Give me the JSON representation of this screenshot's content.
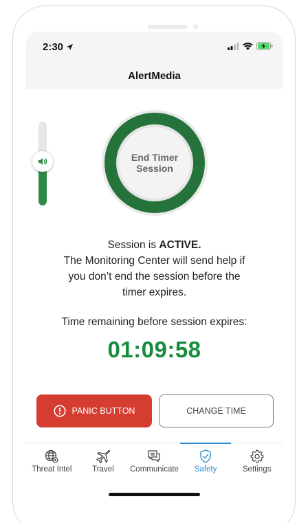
{
  "status_bar": {
    "time": "2:30",
    "icons": [
      "location-arrow-icon",
      "signal-icon",
      "wifi-icon",
      "battery-charging-icon"
    ]
  },
  "header": {
    "title": "AlertMedia"
  },
  "volume_slider": {
    "level": 0.45,
    "icon": "speaker-icon"
  },
  "timer_button": {
    "line1": "End Timer",
    "line2": "Session"
  },
  "session": {
    "prefix": "Session is ",
    "state": "ACTIVE.",
    "line2": "The Monitoring Center will send help if",
    "line3": "you don’t end the session before the",
    "line4": "timer expires."
  },
  "remaining": {
    "label": "Time remaining before session expires:",
    "time": "01:09:58"
  },
  "actions": {
    "panic": "PANIC BUTTON",
    "change": "CHANGE TIME"
  },
  "tabs": [
    {
      "label": "Threat Intel",
      "icon": "globe-icon",
      "active": false
    },
    {
      "label": "Travel",
      "icon": "plane-icon",
      "active": false
    },
    {
      "label": "Communicate",
      "icon": "chat-icon",
      "active": false
    },
    {
      "label": "Safety",
      "icon": "shield-check-icon",
      "active": true
    },
    {
      "label": "Settings",
      "icon": "gear-icon",
      "active": false
    }
  ],
  "colors": {
    "accent_green": "#188b3f",
    "panic_red": "#d63d31",
    "tab_active": "#2b8fcf"
  }
}
